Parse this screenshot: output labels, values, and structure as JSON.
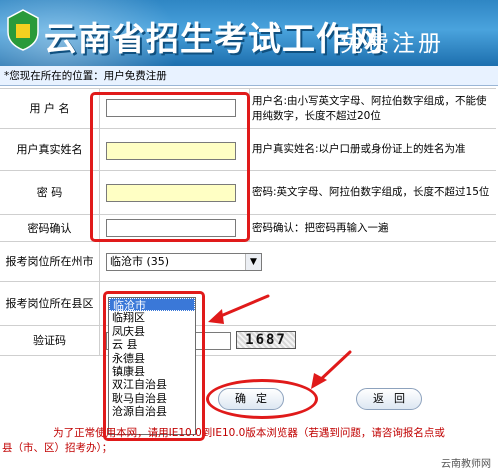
{
  "header": {
    "title": "云南省招生考试工作网",
    "subtitle": "免费注册"
  },
  "breadcrumb": "*您现在所在的位置：用户免费注册",
  "form": {
    "username": {
      "label": "用 户 名",
      "value": "",
      "hint": "用户名:由小写英文字母、阿拉伯数字组成，不能使用纯数字，长度不超过20位"
    },
    "realname": {
      "label": "用户真实姓名",
      "value": "",
      "hint": "用户真实姓名:以户口册或身份证上的姓名为准"
    },
    "password": {
      "label": "密    码",
      "value": "",
      "hint": "密码:英文字母、阿拉伯数字组成，长度不超过15位"
    },
    "confirm": {
      "label": "密码确认",
      "value": "",
      "hint": "密码确认：把密码再输入一遍"
    },
    "city": {
      "label": "报考岗位所在州市",
      "selected": "临沧市 (35)"
    },
    "county": {
      "label": "报考岗位所在县区",
      "options": [
        "临沧市",
        "临翔区",
        "凤庆县",
        "云 县",
        "永德县",
        "镇康县",
        "双江自治县",
        "耿马自治县",
        "沧源自治县"
      ],
      "selected_index": 0
    },
    "captcha": {
      "label": "验证码",
      "value": "",
      "image_text": "1687"
    }
  },
  "buttons": {
    "confirm": "确定",
    "back": "返回"
  },
  "footer": {
    "line1": "为了正常使用本网，请用IE10.0到IE10.0版本浏览器（若遇到问题，请咨询报名点或",
    "line2": "县（市、区）招考办）；"
  },
  "watermark": "云南教师网",
  "colors": {
    "banner": "#2f86c4",
    "annotation": "#e01a1a",
    "highlight_input": "#ffffc4",
    "selected_option": "#3a78d8",
    "footer_text": "#c00000"
  }
}
